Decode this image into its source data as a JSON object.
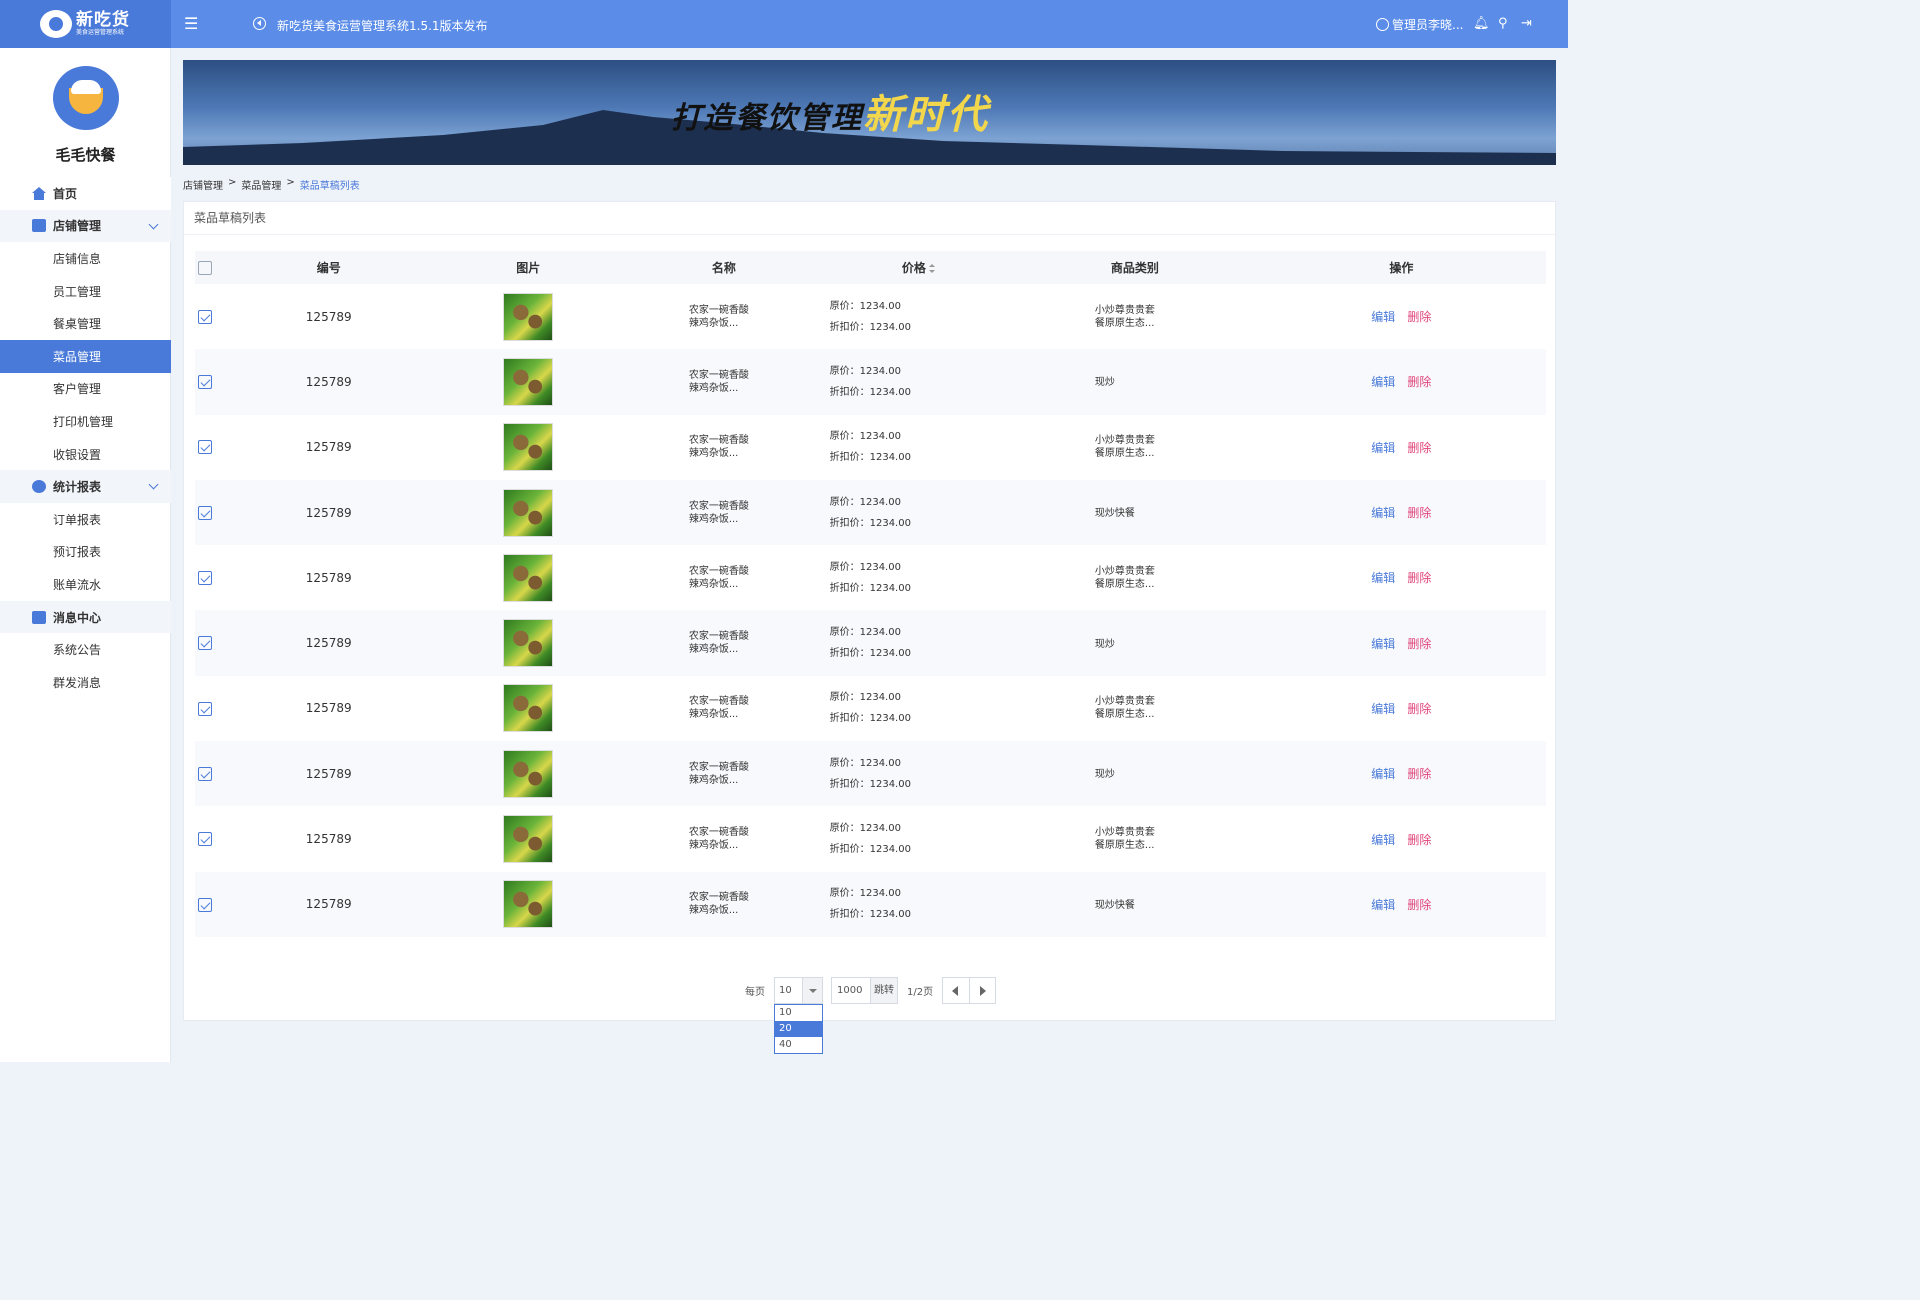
{
  "app": {
    "logo_title": "新吃货",
    "logo_subtitle": "美食运营管理系统",
    "notice": "新吃货美食运营管理系统1.5.1版本发布",
    "user": "管理员李晓..."
  },
  "sidebar": {
    "shop_name": "毛毛快餐",
    "home": "首页",
    "groups": [
      {
        "label": "店铺管理",
        "items": [
          "店铺信息",
          "员工管理",
          "餐桌管理",
          "菜品管理",
          "客户管理",
          "打印机管理",
          "收银设置"
        ]
      },
      {
        "label": "统计报表",
        "items": [
          "订单报表",
          "预订报表",
          "账单流水"
        ]
      },
      {
        "label": "消息中心",
        "items": [
          "系统公告",
          "群发消息"
        ]
      }
    ],
    "active_item": "菜品管理"
  },
  "banner": {
    "slogan_main": "打造餐饮管理",
    "slogan_accent": "新时代"
  },
  "breadcrumb": [
    "店铺管理",
    "菜品管理",
    "菜品草稿列表"
  ],
  "card": {
    "title": "菜品草稿列表"
  },
  "table": {
    "headers": [
      "编号",
      "图片",
      "名称",
      "价格",
      "商品类别",
      "操作"
    ],
    "price_label": "原价：",
    "discount_label": "折扣价：",
    "edit_label": "编辑",
    "delete_label": "删除",
    "rows": [
      {
        "id": "125789",
        "name1": "农家一碗香酸",
        "name2": "辣鸡杂饭...",
        "price": "1234.00",
        "discount": "1234.00",
        "cat1": "小炒尊贵贵套",
        "cat2": "餐原原生态...",
        "checked": true
      },
      {
        "id": "125789",
        "name1": "农家一碗香酸",
        "name2": "辣鸡杂饭...",
        "price": "1234.00",
        "discount": "1234.00",
        "cat1": "现炒",
        "cat2": "",
        "checked": true
      },
      {
        "id": "125789",
        "name1": "农家一碗香酸",
        "name2": "辣鸡杂饭...",
        "price": "1234.00",
        "discount": "1234.00",
        "cat1": "小炒尊贵贵套",
        "cat2": "餐原原生态...",
        "checked": true
      },
      {
        "id": "125789",
        "name1": "农家一碗香酸",
        "name2": "辣鸡杂饭...",
        "price": "1234.00",
        "discount": "1234.00",
        "cat1": "现炒快餐",
        "cat2": "",
        "checked": true
      },
      {
        "id": "125789",
        "name1": "农家一碗香酸",
        "name2": "辣鸡杂饭...",
        "price": "1234.00",
        "discount": "1234.00",
        "cat1": "小炒尊贵贵套",
        "cat2": "餐原原生态...",
        "checked": true
      },
      {
        "id": "125789",
        "name1": "农家一碗香酸",
        "name2": "辣鸡杂饭...",
        "price": "1234.00",
        "discount": "1234.00",
        "cat1": "现炒",
        "cat2": "",
        "checked": true
      },
      {
        "id": "125789",
        "name1": "农家一碗香酸",
        "name2": "辣鸡杂饭...",
        "price": "1234.00",
        "discount": "1234.00",
        "cat1": "小炒尊贵贵套",
        "cat2": "餐原原生态...",
        "checked": true
      },
      {
        "id": "125789",
        "name1": "农家一碗香酸",
        "name2": "辣鸡杂饭...",
        "price": "1234.00",
        "discount": "1234.00",
        "cat1": "现炒",
        "cat2": "",
        "checked": true
      },
      {
        "id": "125789",
        "name1": "农家一碗香酸",
        "name2": "辣鸡杂饭...",
        "price": "1234.00",
        "discount": "1234.00",
        "cat1": "小炒尊贵贵套",
        "cat2": "餐原原生态...",
        "checked": true
      },
      {
        "id": "125789",
        "name1": "农家一碗香酸",
        "name2": "辣鸡杂饭...",
        "price": "1234.00",
        "discount": "1234.00",
        "cat1": "现炒快餐",
        "cat2": "",
        "checked": true
      }
    ]
  },
  "pagination": {
    "per_page_label": "每页",
    "per_page_value": "10",
    "jump_value": "1000",
    "jump_label": "跳转",
    "page_info": "1/2页",
    "options": [
      "10",
      "20",
      "40"
    ],
    "highlighted_option": "20"
  },
  "colors": {
    "topbar": "#5b8de8",
    "primary": "#4a7ad9",
    "delete": "#e0457b"
  }
}
